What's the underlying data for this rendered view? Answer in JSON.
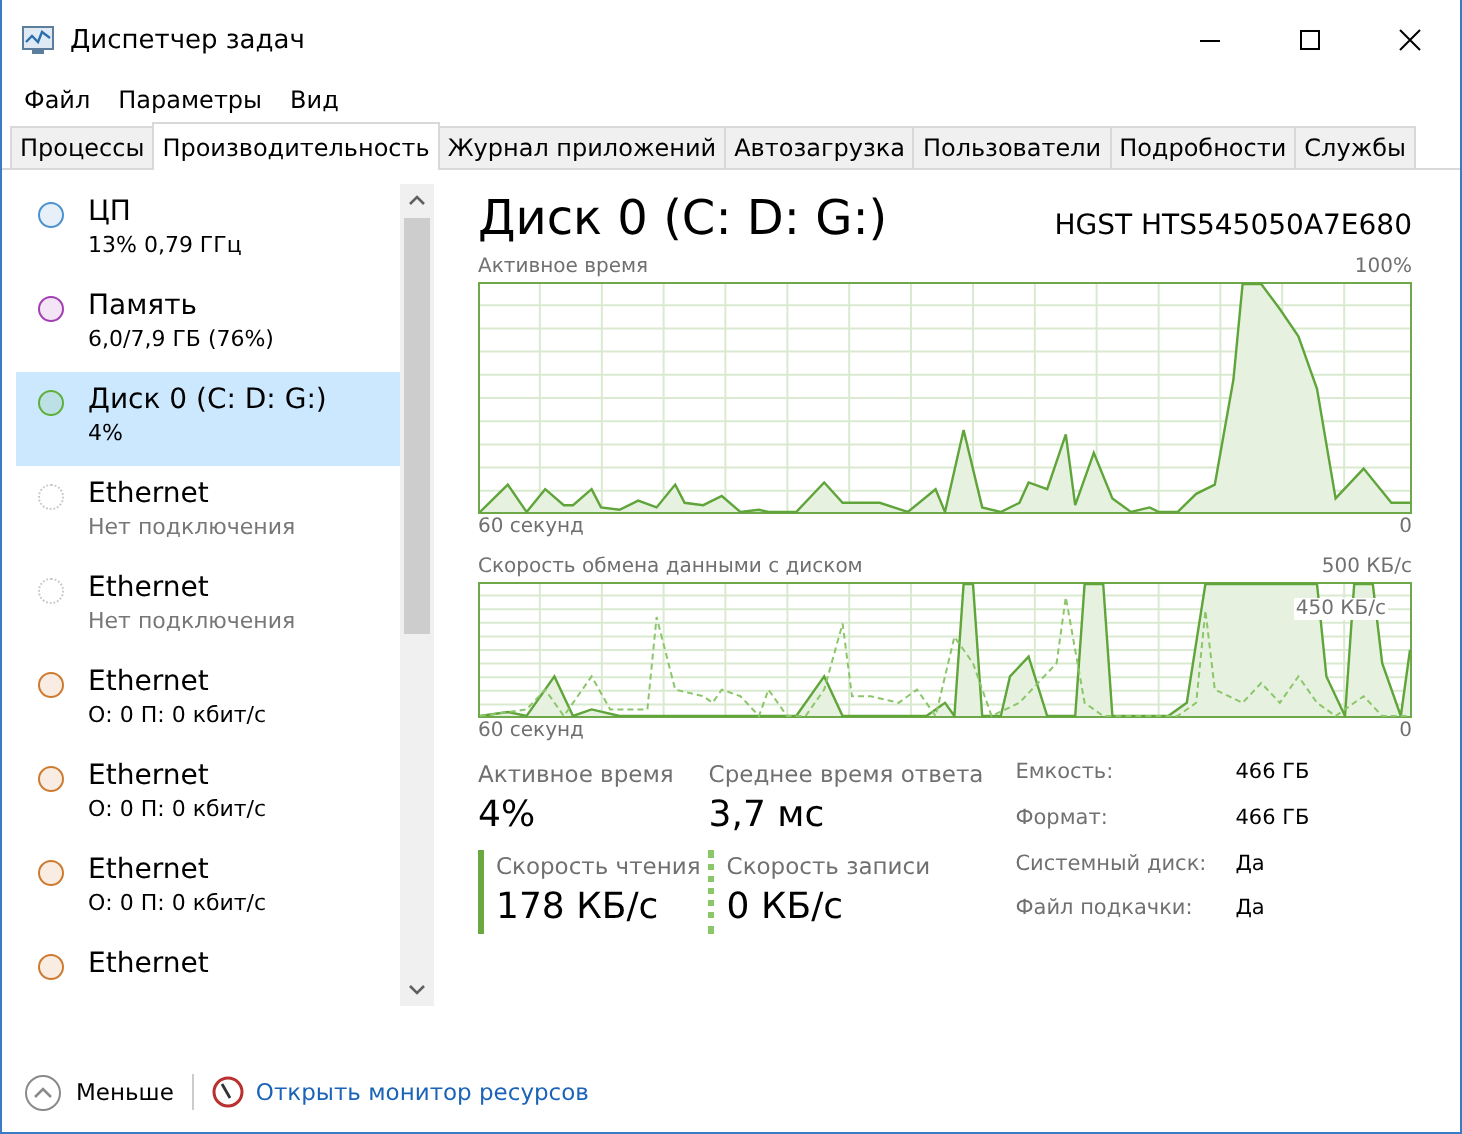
{
  "window": {
    "title": "Диспетчер задач"
  },
  "menu": [
    "Файл",
    "Параметры",
    "Вид"
  ],
  "tabs": [
    {
      "label": "Процессы",
      "selected": false
    },
    {
      "label": "Производительность",
      "selected": true
    },
    {
      "label": "Журнал приложений",
      "selected": false
    },
    {
      "label": "Автозагрузка",
      "selected": false
    },
    {
      "label": "Пользователи",
      "selected": false
    },
    {
      "label": "Подробности",
      "selected": false
    },
    {
      "label": "Службы",
      "selected": false
    }
  ],
  "sidebar": {
    "items": [
      {
        "name": "ЦП",
        "detail": "13% 0,79 ГГц",
        "color": "#4a92d0",
        "selected": false,
        "connected": true
      },
      {
        "name": "Память",
        "detail": "6,0/7,9 ГБ (76%)",
        "color": "#a23fb4",
        "selected": false,
        "connected": true
      },
      {
        "name": "Диск 0 (C: D: G:)",
        "detail": "4%",
        "color": "#5db03a",
        "selected": true,
        "connected": true
      },
      {
        "name": "Ethernet",
        "detail": "Нет подключения",
        "color": "#c8c8c8",
        "selected": false,
        "connected": false
      },
      {
        "name": "Ethernet",
        "detail": "Нет подключения",
        "color": "#c8c8c8",
        "selected": false,
        "connected": false
      },
      {
        "name": "Ethernet",
        "detail": "О: 0 П: 0 кбит/с",
        "color": "#d07a30",
        "selected": false,
        "connected": true
      },
      {
        "name": "Ethernet",
        "detail": "О: 0 П: 0 кбит/с",
        "color": "#d07a30",
        "selected": false,
        "connected": true
      },
      {
        "name": "Ethernet",
        "detail": "О: 0 П: 0 кбит/с",
        "color": "#d07a30",
        "selected": false,
        "connected": true
      },
      {
        "name": "Ethernet",
        "color": "#d07a30",
        "selected": false,
        "connected": true
      }
    ]
  },
  "footer": {
    "less": "Меньше",
    "link": "Открыть монитор ресурсов"
  },
  "main": {
    "title": "Диск 0 (C: D: G:)",
    "model": "HGST HTS545050A7E680",
    "graphs": [
      {
        "kind": "active",
        "label": "Активное время",
        "max": "100%",
        "xlabel": "60 секунд",
        "min": "0"
      },
      {
        "kind": "transfer",
        "label": "Скорость обмена данными с диском",
        "max": "500 КБ/с",
        "overlay": "450 КБ/с",
        "xlabel": "60 секунд",
        "min": "0"
      }
    ],
    "stats": [
      {
        "kind": "plain",
        "label": "Активное время",
        "value": "4%"
      },
      {
        "kind": "plain",
        "label": "Среднее время ответа",
        "value": "3,7 мс"
      },
      {
        "kind": "read",
        "label": "Скорость чтения",
        "value": "178 КБ/с"
      },
      {
        "kind": "write",
        "label": "Скорость записи",
        "value": "0 КБ/с"
      }
    ],
    "properties": [
      {
        "label": "Емкость:",
        "value": "466 ГБ"
      },
      {
        "label": "Формат:",
        "value": "466 ГБ"
      },
      {
        "label": "Системный диск:",
        "value": "Да"
      },
      {
        "label": "Файл подкачки:",
        "value": "Да"
      }
    ]
  }
}
